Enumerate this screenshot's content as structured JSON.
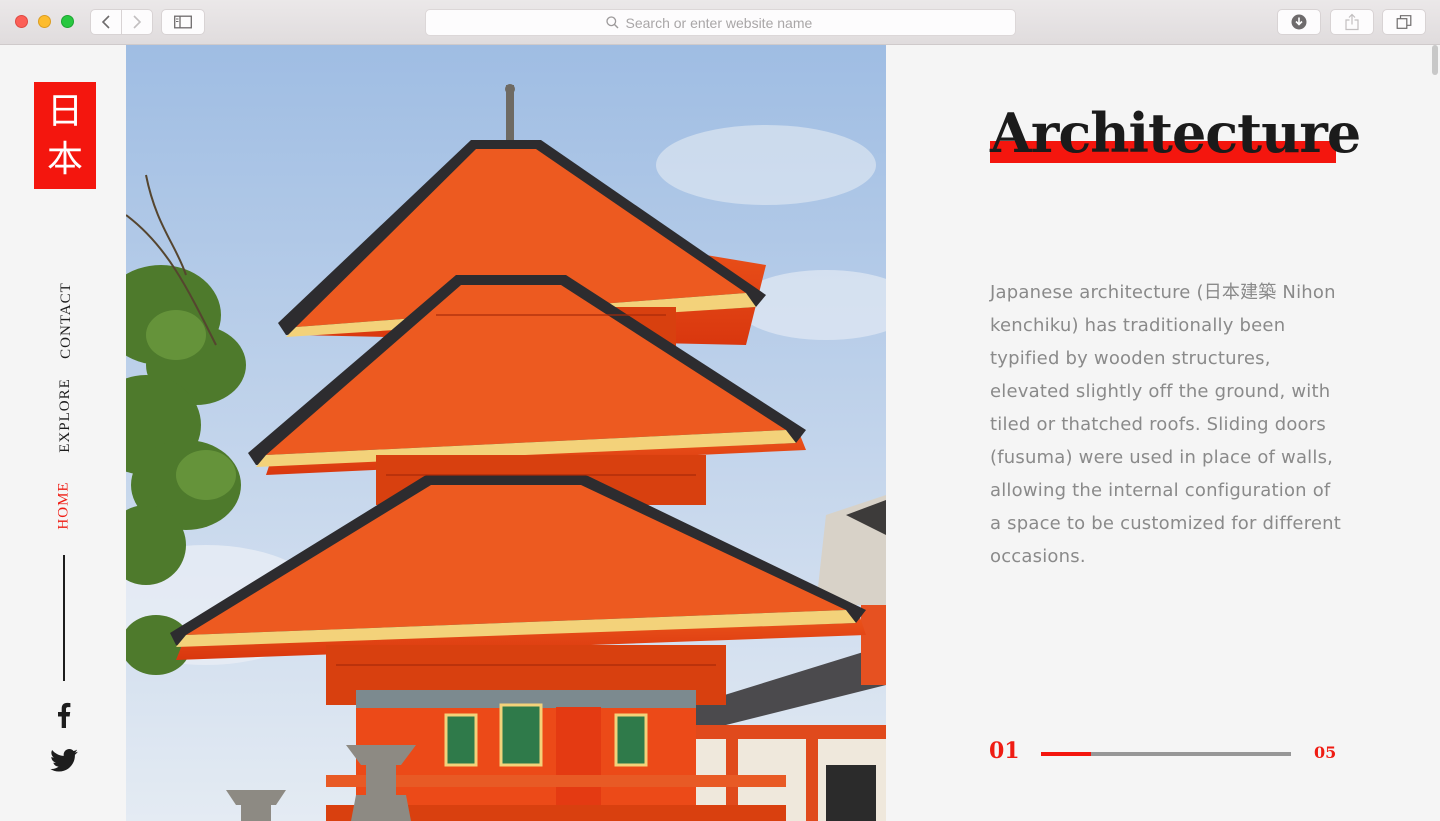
{
  "browser": {
    "address_placeholder": "Search or enter website name"
  },
  "sidebar": {
    "logo_chars": [
      "日",
      "本"
    ],
    "nav": [
      {
        "label": "CONTACT",
        "active": false
      },
      {
        "label": "EXPLORE",
        "active": false
      },
      {
        "label": "HOME",
        "active": true
      }
    ],
    "social": [
      "facebook-icon",
      "twitter-icon"
    ]
  },
  "main": {
    "title": "Architecture",
    "description": "Japanese architecture (日本建築 Nihon kenchiku) has traditionally been typified by wooden structures, elevated slightly off the ground, with tiled or thatched roofs. Sliding doors (fusuma) were used in place of walls, allowing the internal configuration of a space to be customized for different occasions.",
    "pager": {
      "current": "01",
      "total": "05",
      "progress": 0.2
    }
  },
  "colors": {
    "accent": "#f4160e",
    "text_dark": "#1b1b1b",
    "text_muted": "#8a8a8a",
    "background": "#f5f5f5"
  }
}
